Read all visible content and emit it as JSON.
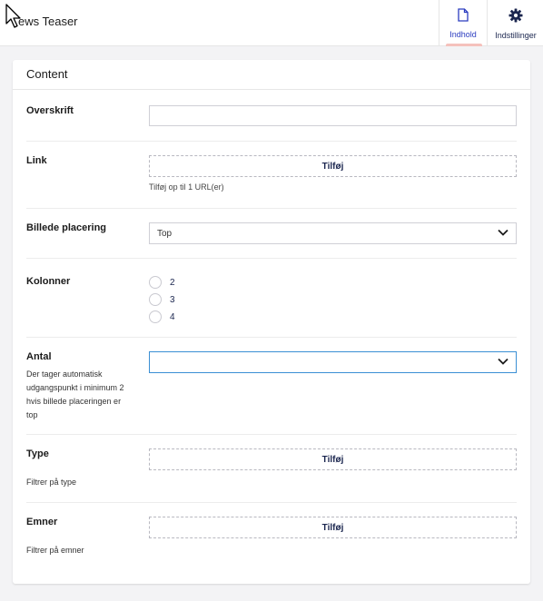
{
  "header": {
    "title": "ews Teaser",
    "tabs": [
      {
        "label": "Indhold",
        "icon": "document-icon",
        "active": true
      },
      {
        "label": "Indstillinger",
        "icon": "gear-icon",
        "active": false
      }
    ]
  },
  "panel": {
    "title": "Content",
    "fields": {
      "overskrift": {
        "label": "Overskrift",
        "value": ""
      },
      "link": {
        "label": "Link",
        "button": "Tilføj",
        "helper": "Tilføj op til 1 URL(er)"
      },
      "billede": {
        "label": "Billede placering",
        "selected": "Top"
      },
      "kolonner": {
        "label": "Kolonner",
        "options": [
          "2",
          "3",
          "4"
        ]
      },
      "antal": {
        "label": "Antal",
        "description": [
          "Der tager automatisk",
          "udgangspunkt i minimum 2",
          "hvis billede placeringen er",
          "top"
        ],
        "selected": ""
      },
      "type": {
        "label": "Type",
        "button": "Tilføj",
        "description": "Filtrer på type"
      },
      "emner": {
        "label": "Emner",
        "button": "Tilføj",
        "description": "Filtrer på emner"
      }
    }
  },
  "colors": {
    "accent_blue": "#2b3cbf",
    "focus_blue": "#3a8fd4",
    "tab_underline": "#f5c1bc",
    "text_navy": "#1b264f"
  }
}
